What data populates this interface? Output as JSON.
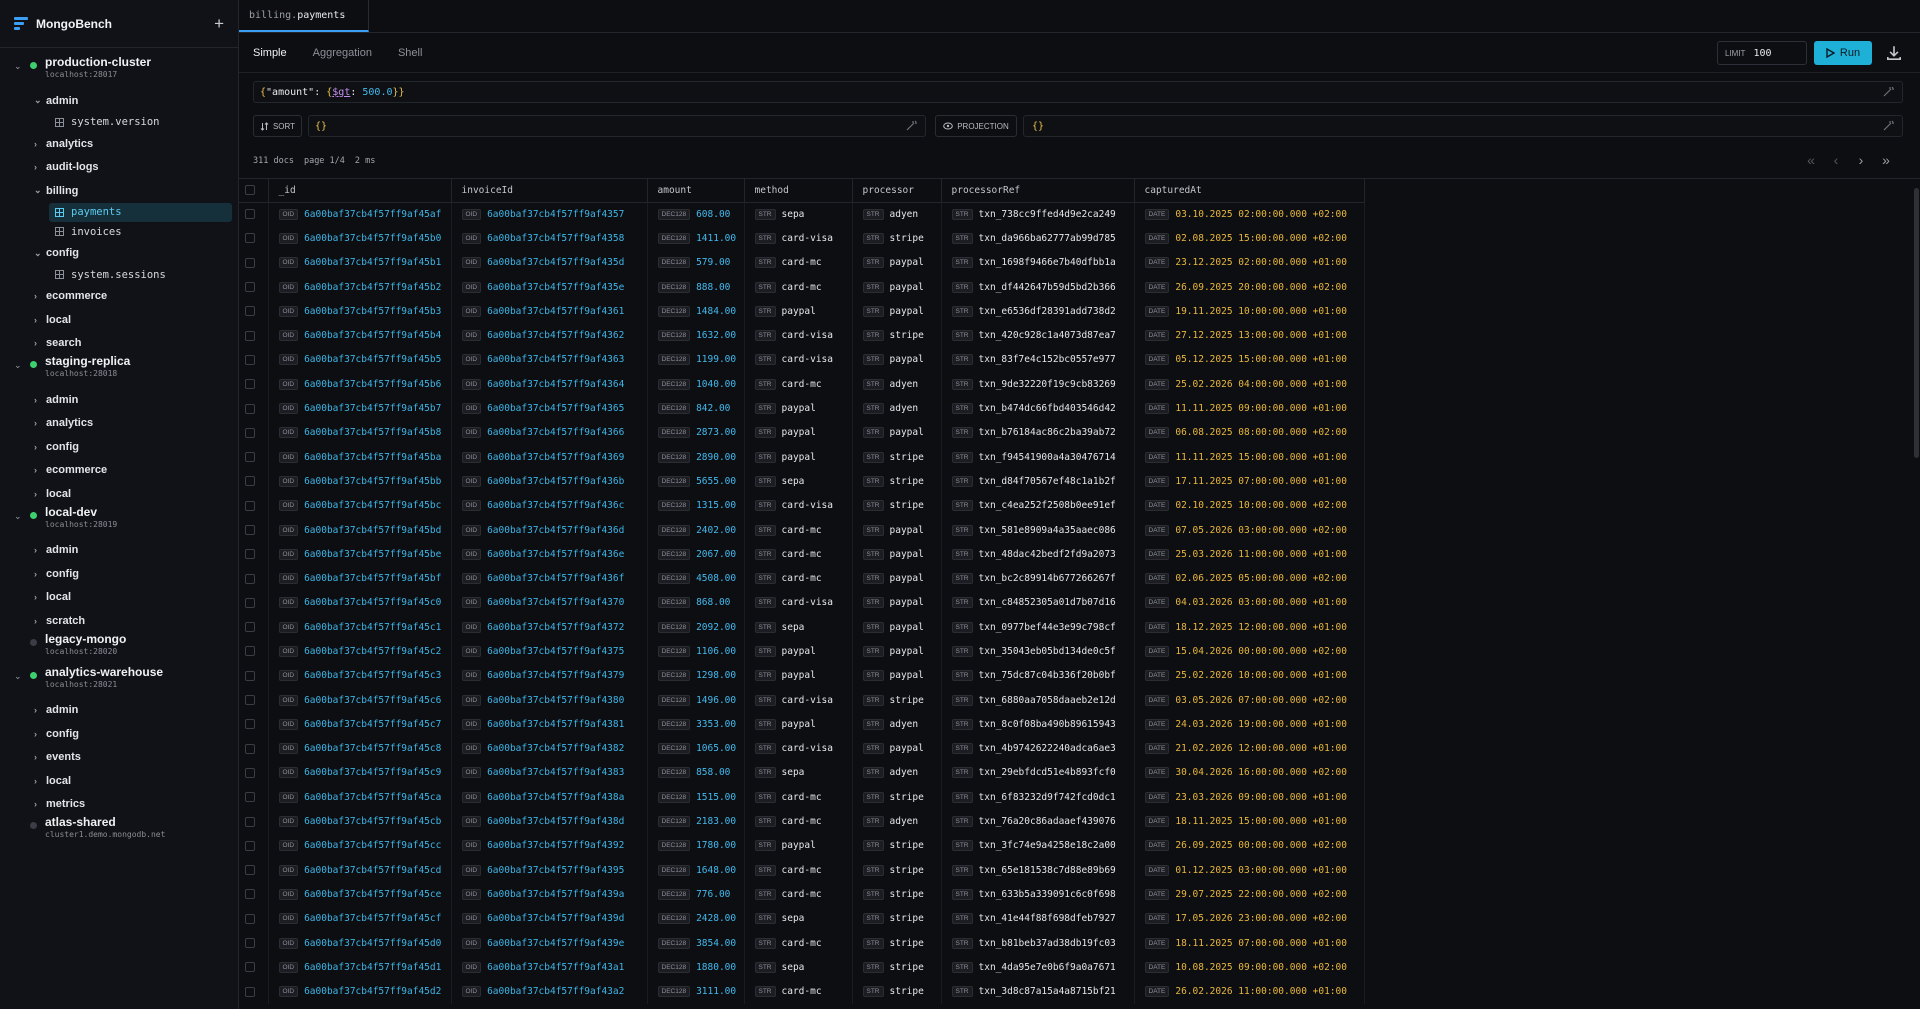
{
  "app": {
    "name": "MongoBench"
  },
  "tree": [
    {
      "name": "production-cluster",
      "host": "localhost:28017",
      "connected": true,
      "expanded": true,
      "dbs": [
        {
          "name": "admin",
          "expanded": true,
          "collections": [
            {
              "name": "system.version",
              "active": false
            }
          ]
        },
        {
          "name": "analytics",
          "expanded": false,
          "collections": []
        },
        {
          "name": "audit-logs",
          "expanded": false,
          "collections": []
        },
        {
          "name": "billing",
          "expanded": true,
          "collections": [
            {
              "name": "payments",
              "active": true
            },
            {
              "name": "invoices",
              "active": false
            }
          ]
        },
        {
          "name": "config",
          "expanded": true,
          "collections": [
            {
              "name": "system.sessions",
              "active": false
            }
          ]
        },
        {
          "name": "ecommerce",
          "expanded": false,
          "collections": []
        },
        {
          "name": "local",
          "expanded": false,
          "collections": []
        },
        {
          "name": "search",
          "expanded": false,
          "collections": []
        }
      ]
    },
    {
      "name": "staging-replica",
      "host": "localhost:28018",
      "connected": true,
      "expanded": true,
      "dbs": [
        {
          "name": "admin",
          "expanded": false,
          "collections": []
        },
        {
          "name": "analytics",
          "expanded": false,
          "collections": []
        },
        {
          "name": "config",
          "expanded": false,
          "collections": []
        },
        {
          "name": "ecommerce",
          "expanded": false,
          "collections": []
        },
        {
          "name": "local",
          "expanded": false,
          "collections": []
        }
      ]
    },
    {
      "name": "local-dev",
      "host": "localhost:28019",
      "connected": true,
      "expanded": true,
      "dbs": [
        {
          "name": "admin",
          "expanded": false,
          "collections": []
        },
        {
          "name": "config",
          "expanded": false,
          "collections": []
        },
        {
          "name": "local",
          "expanded": false,
          "collections": []
        },
        {
          "name": "scratch",
          "expanded": false,
          "collections": []
        }
      ]
    },
    {
      "name": "legacy-mongo",
      "host": "localhost:28020",
      "connected": false,
      "expanded": false,
      "dbs": []
    },
    {
      "name": "analytics-warehouse",
      "host": "localhost:28021",
      "connected": true,
      "expanded": true,
      "dbs": [
        {
          "name": "admin",
          "expanded": false,
          "collections": []
        },
        {
          "name": "config",
          "expanded": false,
          "collections": []
        },
        {
          "name": "events",
          "expanded": false,
          "collections": []
        },
        {
          "name": "local",
          "expanded": false,
          "collections": []
        },
        {
          "name": "metrics",
          "expanded": false,
          "collections": []
        }
      ]
    },
    {
      "name": "atlas-shared",
      "host": "cluster1.demo.mongodb.net",
      "connected": false,
      "expanded": false,
      "dbs": []
    }
  ],
  "tab": {
    "db": "billing",
    "collection": "payments"
  },
  "modes": [
    "Simple",
    "Aggregation",
    "Shell"
  ],
  "active_mode": "Simple",
  "limit": {
    "label": "LIMIT",
    "value": "100"
  },
  "run_label": "Run",
  "filter": {
    "key": "\"amount\"",
    "op": "$gt",
    "val": "500.0"
  },
  "sort": {
    "label": "SORT",
    "value": "{}"
  },
  "projection": {
    "label": "PROJECTION",
    "value": "{}"
  },
  "stats": {
    "docs": "311 docs",
    "page": "page 1/4",
    "time": "2 ms"
  },
  "columns": [
    "_id",
    "invoiceId",
    "amount",
    "method",
    "processor",
    "processorRef",
    "capturedAt"
  ],
  "type_tags": {
    "oid": "OID",
    "dec": "DEC128",
    "str": "STR",
    "date": "DATE"
  },
  "rows": [
    [
      "6a00baf37cb4f57ff9af45af",
      "6a00baf37cb4f57ff9af4357",
      "608.00",
      "sepa",
      "adyen",
      "txn_738cc9ffed4d9e2ca249",
      "03.10.2025 02:00:00.000 +02:00"
    ],
    [
      "6a00baf37cb4f57ff9af45b0",
      "6a00baf37cb4f57ff9af4358",
      "1411.00",
      "card-visa",
      "stripe",
      "txn_da966ba62777ab99d785",
      "02.08.2025 15:00:00.000 +02:00"
    ],
    [
      "6a00baf37cb4f57ff9af45b1",
      "6a00baf37cb4f57ff9af435d",
      "579.00",
      "card-mc",
      "paypal",
      "txn_1698f9466e7b40dfbb1a",
      "23.12.2025 02:00:00.000 +01:00"
    ],
    [
      "6a00baf37cb4f57ff9af45b2",
      "6a00baf37cb4f57ff9af435e",
      "888.00",
      "card-mc",
      "paypal",
      "txn_df442647b59d5bd2b366",
      "26.09.2025 20:00:00.000 +02:00"
    ],
    [
      "6a00baf37cb4f57ff9af45b3",
      "6a00baf37cb4f57ff9af4361",
      "1484.00",
      "paypal",
      "paypal",
      "txn_e6536df28391add738d2",
      "19.11.2025 10:00:00.000 +01:00"
    ],
    [
      "6a00baf37cb4f57ff9af45b4",
      "6a00baf37cb4f57ff9af4362",
      "1632.00",
      "card-visa",
      "stripe",
      "txn_420c928c1a4073d87ea7",
      "27.12.2025 13:00:00.000 +01:00"
    ],
    [
      "6a00baf37cb4f57ff9af45b5",
      "6a00baf37cb4f57ff9af4363",
      "1199.00",
      "card-visa",
      "paypal",
      "txn_83f7e4c152bc0557e977",
      "05.12.2025 15:00:00.000 +01:00"
    ],
    [
      "6a00baf37cb4f57ff9af45b6",
      "6a00baf37cb4f57ff9af4364",
      "1040.00",
      "card-mc",
      "adyen",
      "txn_9de32220f19c9cb83269",
      "25.02.2026 04:00:00.000 +01:00"
    ],
    [
      "6a00baf37cb4f57ff9af45b7",
      "6a00baf37cb4f57ff9af4365",
      "842.00",
      "paypal",
      "adyen",
      "txn_b474dc66fbd403546d42",
      "11.11.2025 09:00:00.000 +01:00"
    ],
    [
      "6a00baf37cb4f57ff9af45b8",
      "6a00baf37cb4f57ff9af4366",
      "2873.00",
      "paypal",
      "paypal",
      "txn_b76184ac86c2ba39ab72",
      "06.08.2025 08:00:00.000 +02:00"
    ],
    [
      "6a00baf37cb4f57ff9af45ba",
      "6a00baf37cb4f57ff9af4369",
      "2890.00",
      "paypal",
      "stripe",
      "txn_f94541900a4a30476714",
      "11.11.2025 15:00:00.000 +01:00"
    ],
    [
      "6a00baf37cb4f57ff9af45bb",
      "6a00baf37cb4f57ff9af436b",
      "5655.00",
      "sepa",
      "stripe",
      "txn_d84f70567ef48c1a1b2f",
      "17.11.2025 07:00:00.000 +01:00"
    ],
    [
      "6a00baf37cb4f57ff9af45bc",
      "6a00baf37cb4f57ff9af436c",
      "1315.00",
      "card-visa",
      "stripe",
      "txn_c4ea252f2508b0ee91ef",
      "02.10.2025 10:00:00.000 +02:00"
    ],
    [
      "6a00baf37cb4f57ff9af45bd",
      "6a00baf37cb4f57ff9af436d",
      "2402.00",
      "card-mc",
      "paypal",
      "txn_581e8909a4a35aaec086",
      "07.05.2026 03:00:00.000 +02:00"
    ],
    [
      "6a00baf37cb4f57ff9af45be",
      "6a00baf37cb4f57ff9af436e",
      "2067.00",
      "card-mc",
      "paypal",
      "txn_48dac42bedf2fd9a2073",
      "25.03.2026 11:00:00.000 +01:00"
    ],
    [
      "6a00baf37cb4f57ff9af45bf",
      "6a00baf37cb4f57ff9af436f",
      "4508.00",
      "card-mc",
      "paypal",
      "txn_bc2c89914b677266267f",
      "02.06.2025 05:00:00.000 +02:00"
    ],
    [
      "6a00baf37cb4f57ff9af45c0",
      "6a00baf37cb4f57ff9af4370",
      "868.00",
      "card-visa",
      "paypal",
      "txn_c84852305a01d7b07d16",
      "04.03.2026 03:00:00.000 +01:00"
    ],
    [
      "6a00baf37cb4f57ff9af45c1",
      "6a00baf37cb4f57ff9af4372",
      "2092.00",
      "sepa",
      "paypal",
      "txn_0977bef44e3e99c798cf",
      "18.12.2025 12:00:00.000 +01:00"
    ],
    [
      "6a00baf37cb4f57ff9af45c2",
      "6a00baf37cb4f57ff9af4375",
      "1106.00",
      "paypal",
      "paypal",
      "txn_35043eb05bd134de0c5f",
      "15.04.2026 00:00:00.000 +02:00"
    ],
    [
      "6a00baf37cb4f57ff9af45c3",
      "6a00baf37cb4f57ff9af4379",
      "1298.00",
      "paypal",
      "paypal",
      "txn_75dc87c04b336f20b0bf",
      "25.02.2026 10:00:00.000 +01:00"
    ],
    [
      "6a00baf37cb4f57ff9af45c6",
      "6a00baf37cb4f57ff9af4380",
      "1496.00",
      "card-visa",
      "stripe",
      "txn_6880aa7058daaeb2e12d",
      "03.05.2026 07:00:00.000 +02:00"
    ],
    [
      "6a00baf37cb4f57ff9af45c7",
      "6a00baf37cb4f57ff9af4381",
      "3353.00",
      "paypal",
      "adyen",
      "txn_8c0f08ba490b89615943",
      "24.03.2026 19:00:00.000 +01:00"
    ],
    [
      "6a00baf37cb4f57ff9af45c8",
      "6a00baf37cb4f57ff9af4382",
      "1065.00",
      "card-visa",
      "paypal",
      "txn_4b9742622240adca6ae3",
      "21.02.2026 12:00:00.000 +01:00"
    ],
    [
      "6a00baf37cb4f57ff9af45c9",
      "6a00baf37cb4f57ff9af4383",
      "858.00",
      "sepa",
      "adyen",
      "txn_29ebfdcd51e4b893fcf0",
      "30.04.2026 16:00:00.000 +02:00"
    ],
    [
      "6a00baf37cb4f57ff9af45ca",
      "6a00baf37cb4f57ff9af438a",
      "1515.00",
      "card-mc",
      "stripe",
      "txn_6f83232d9f742fcd0dc1",
      "23.03.2026 09:00:00.000 +01:00"
    ],
    [
      "6a00baf37cb4f57ff9af45cb",
      "6a00baf37cb4f57ff9af438d",
      "2183.00",
      "card-mc",
      "adyen",
      "txn_76a20c86adaaef439076",
      "18.11.2025 15:00:00.000 +01:00"
    ],
    [
      "6a00baf37cb4f57ff9af45cc",
      "6a00baf37cb4f57ff9af4392",
      "1780.00",
      "paypal",
      "stripe",
      "txn_3fc74e9a4258e18c2a00",
      "26.09.2025 00:00:00.000 +02:00"
    ],
    [
      "6a00baf37cb4f57ff9af45cd",
      "6a00baf37cb4f57ff9af4395",
      "1648.00",
      "card-mc",
      "stripe",
      "txn_65e181538c7d88e89b69",
      "01.12.2025 03:00:00.000 +01:00"
    ],
    [
      "6a00baf37cb4f57ff9af45ce",
      "6a00baf37cb4f57ff9af439a",
      "776.00",
      "card-mc",
      "stripe",
      "txn_633b5a339091c6c0f698",
      "29.07.2025 22:00:00.000 +02:00"
    ],
    [
      "6a00baf37cb4f57ff9af45cf",
      "6a00baf37cb4f57ff9af439d",
      "2428.00",
      "sepa",
      "stripe",
      "txn_41e44f88f698dfeb7927",
      "17.05.2026 23:00:00.000 +02:00"
    ],
    [
      "6a00baf37cb4f57ff9af45d0",
      "6a00baf37cb4f57ff9af439e",
      "3854.00",
      "card-mc",
      "stripe",
      "txn_b81beb37ad38db19fc03",
      "18.11.2025 07:00:00.000 +01:00"
    ],
    [
      "6a00baf37cb4f57ff9af45d1",
      "6a00baf37cb4f57ff9af43a1",
      "1880.00",
      "sepa",
      "stripe",
      "txn_4da95e7e0b6f9a0a7671",
      "10.08.2025 09:00:00.000 +02:00"
    ],
    [
      "6a00baf37cb4f57ff9af45d2",
      "6a00baf37cb4f57ff9af43a2",
      "3111.00",
      "card-mc",
      "stripe",
      "txn_3d8c87a15a4a8715bf21",
      "26.02.2026 11:00:00.000 +01:00"
    ]
  ]
}
